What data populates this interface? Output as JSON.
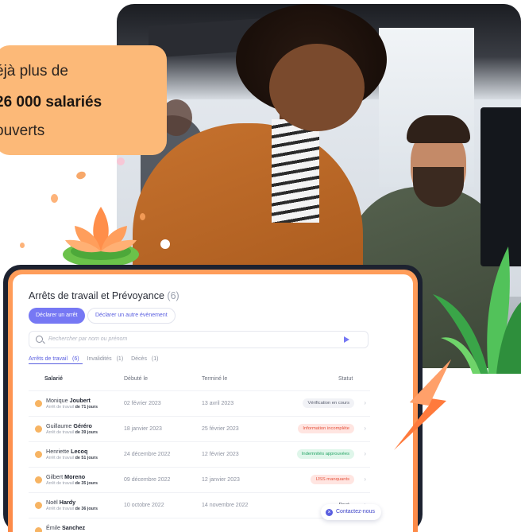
{
  "quote": {
    "line1": "éjà plus de",
    "line2": "26 000 salariés",
    "line3": "ouverts"
  },
  "app": {
    "title": "Arrêts de travail et Prévoyance",
    "title_count": "(6)",
    "primary_button": "Déclarer un arrêt",
    "secondary_button": "Déclarer un autre évènement",
    "search_placeholder": "Rechercher par nom ou prénom",
    "tabs": [
      {
        "label": "Arrêts de travail",
        "count": "(6)"
      },
      {
        "label": "Invalidités",
        "count": "(1)"
      },
      {
        "label": "Décès",
        "count": "(1)"
      }
    ],
    "columns": {
      "employee": "Salarié",
      "start": "Débuté le",
      "end": "Terminé le",
      "status": "Statut"
    },
    "rows": [
      {
        "first": "Monique",
        "last": "Joubert",
        "sub_prefix": "Arrêt de travail",
        "duration": "de 71 jours",
        "start": "02 février 2023",
        "end": "13 avril 2023",
        "status": "Vérification en cours",
        "status_color": "#f1f2f6",
        "status_text_color": "#5b6070"
      },
      {
        "first": "Guillaume",
        "last": "Géréro",
        "sub_prefix": "Arrêt de travail",
        "duration": "de 39 jours",
        "start": "18 janvier 2023",
        "end": "25 février 2023",
        "status": "Information incomplète",
        "status_color": "#ffe5e1",
        "status_text_color": "#e5533d"
      },
      {
        "first": "Henriette",
        "last": "Lecoq",
        "sub_prefix": "Arrêt de travail",
        "duration": "de 51 jours",
        "start": "24 décembre 2022",
        "end": "12 février 2023",
        "status": "Indemnités approuvées",
        "status_color": "#dff6ea",
        "status_text_color": "#26a566"
      },
      {
        "first": "Gilbert",
        "last": "Moreno",
        "sub_prefix": "Arrêt de travail",
        "duration": "de 35 jours",
        "start": "09 décembre 2022",
        "end": "12 janvier 2023",
        "status": "IJSS manquants",
        "status_color": "#ffe5e1",
        "status_text_color": "#e5533d"
      },
      {
        "first": "Noël",
        "last": "Hardy",
        "sub_prefix": "Arrêt de travail",
        "duration": "de 36 jours",
        "start": "10 octobre 2022",
        "end": "14 novembre 2022",
        "status": "Payé",
        "status_color": "#ffffff",
        "status_text_color": "#3a3f4b"
      },
      {
        "first": "Émile",
        "last": "Sanchez",
        "sub_prefix": "",
        "duration": "",
        "start": "",
        "end": "",
        "status": "",
        "status_color": "#ffffff",
        "status_text_color": "#3a3f4b"
      }
    ],
    "contact_label": "Contactez-nous"
  },
  "colors": {
    "quote_bg": "#fcb978",
    "primary": "#7678f4",
    "tablet_frame": "#fd8a48"
  }
}
